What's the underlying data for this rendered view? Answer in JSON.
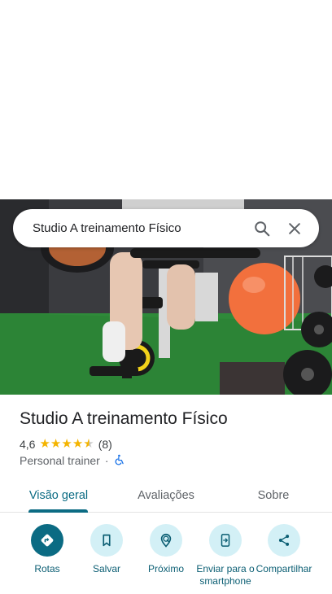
{
  "search": {
    "query": "Studio A treinamento Físico"
  },
  "place": {
    "name": "Studio A treinamento Físico",
    "rating": "4,6",
    "review_count": "(8)",
    "stars": 4.6,
    "category": "Personal trainer",
    "separator": "·"
  },
  "tabs": [
    {
      "label": "Visão geral",
      "active": true
    },
    {
      "label": "Avaliações",
      "active": false
    },
    {
      "label": "Sobre",
      "active": false
    }
  ],
  "actions": [
    {
      "label": "Rotas",
      "icon": "directions-icon"
    },
    {
      "label": "Salvar",
      "icon": "bookmark-icon"
    },
    {
      "label": "Próximo",
      "icon": "nearby-icon"
    },
    {
      "label": "Enviar para o smartphone",
      "icon": "send-to-phone-icon"
    },
    {
      "label": "Compartilhar",
      "icon": "share-icon"
    }
  ],
  "colors": {
    "accent": "#0b6b83",
    "chip": "#d3f0f6",
    "star": "#f4b400"
  }
}
